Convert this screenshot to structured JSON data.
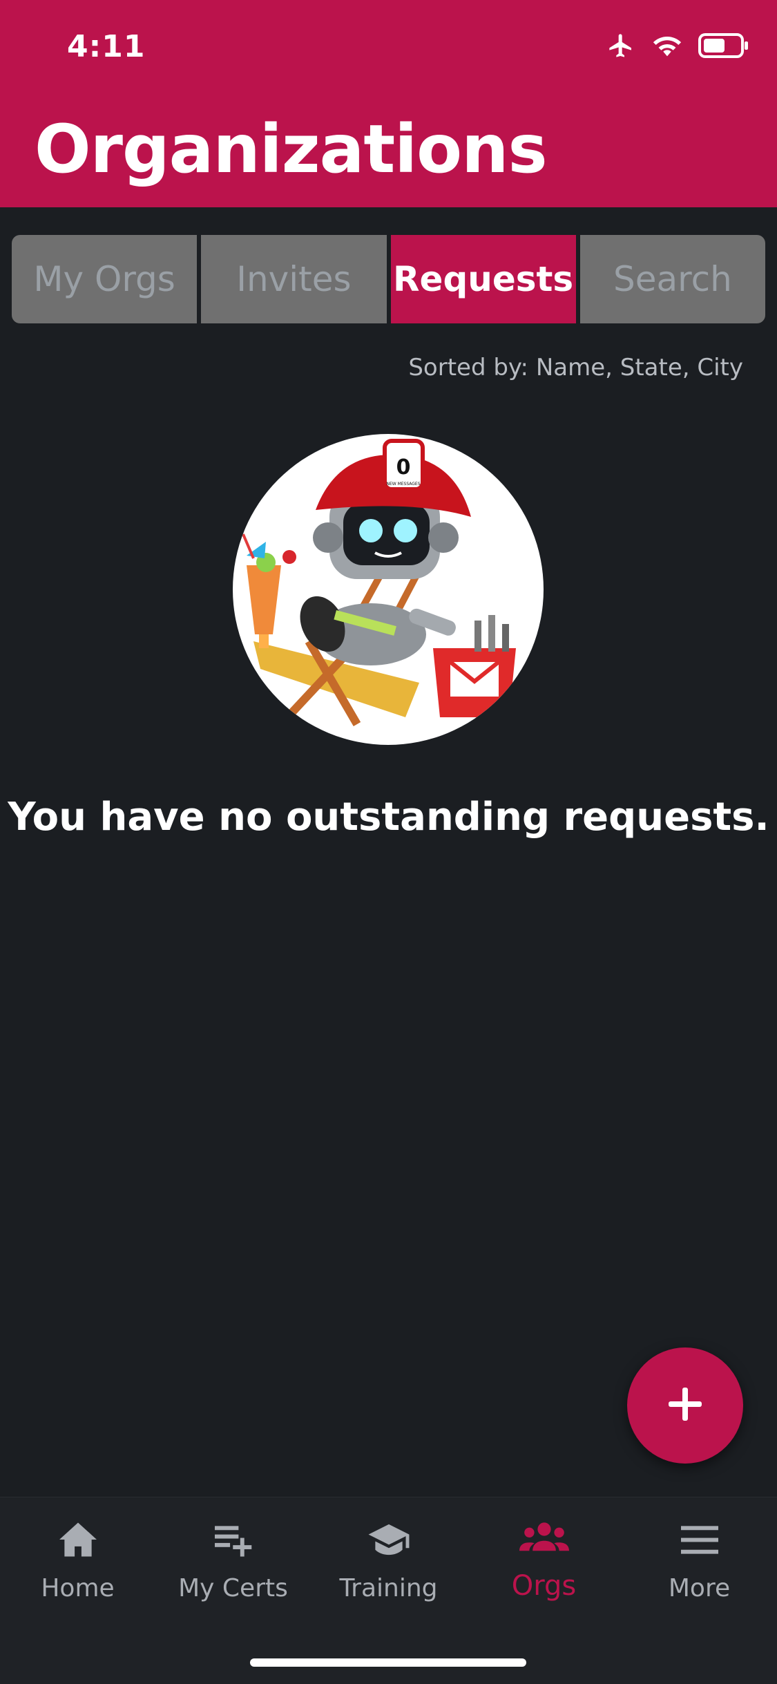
{
  "status": {
    "time": "4:11"
  },
  "header": {
    "title": "Organizations"
  },
  "tabs": [
    {
      "label": "My Orgs",
      "active": false
    },
    {
      "label": "Invites",
      "active": false
    },
    {
      "label": "Requests",
      "active": true
    },
    {
      "label": "Search",
      "active": false
    }
  ],
  "sort": {
    "label": "Sorted by: Name, State, City"
  },
  "mascot": {
    "badge": "0",
    "badge_caption": "NEW MESSAGES"
  },
  "empty_state": {
    "message": "You have no outstanding requests."
  },
  "fab": {
    "icon": "plus-icon"
  },
  "bottom_nav": [
    {
      "label": "Home",
      "icon": "home-icon",
      "active": false
    },
    {
      "label": "My Certs",
      "icon": "playlist-add-icon",
      "active": false
    },
    {
      "label": "Training",
      "icon": "graduation-cap-icon",
      "active": false
    },
    {
      "label": "Orgs",
      "icon": "people-icon",
      "active": true
    },
    {
      "label": "More",
      "icon": "menu-icon",
      "active": false
    }
  ],
  "colors": {
    "brand": "#bb134c",
    "background": "#1b1e22",
    "tab_inactive": "#707070"
  }
}
